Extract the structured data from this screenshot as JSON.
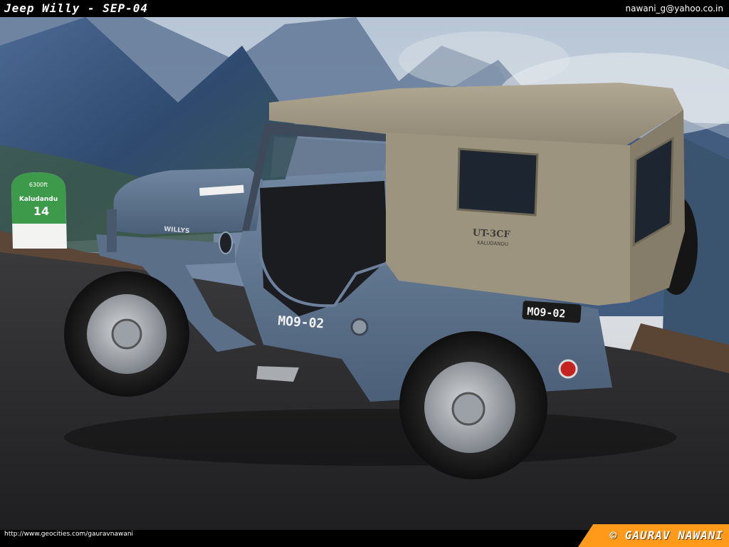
{
  "header": {
    "title": "Jeep Willy - SEP-04",
    "email": "nawani_g@yahoo.co.in"
  },
  "scene": {
    "milestone": {
      "altitude": "6300ft",
      "place": "Kaludandu",
      "number": "14"
    },
    "hood_badge": "WILLYS",
    "registration_side": "MO9-02",
    "registration_rear": "MO9-02",
    "canvas_marking": {
      "code": "UT-3CF",
      "place": "KALUDANDU"
    },
    "colors": {
      "jeep_body": "#5f7591",
      "canvas_top": "#a39b88",
      "road": "#2b2b2d",
      "sky": "#c9d4dc",
      "mountain": "#3f587c"
    }
  },
  "footer": {
    "url": "http://www.geocities.com/gauravnawani",
    "credit": "© GAURAV NAWANI",
    "accent": "#ff9a1a"
  }
}
